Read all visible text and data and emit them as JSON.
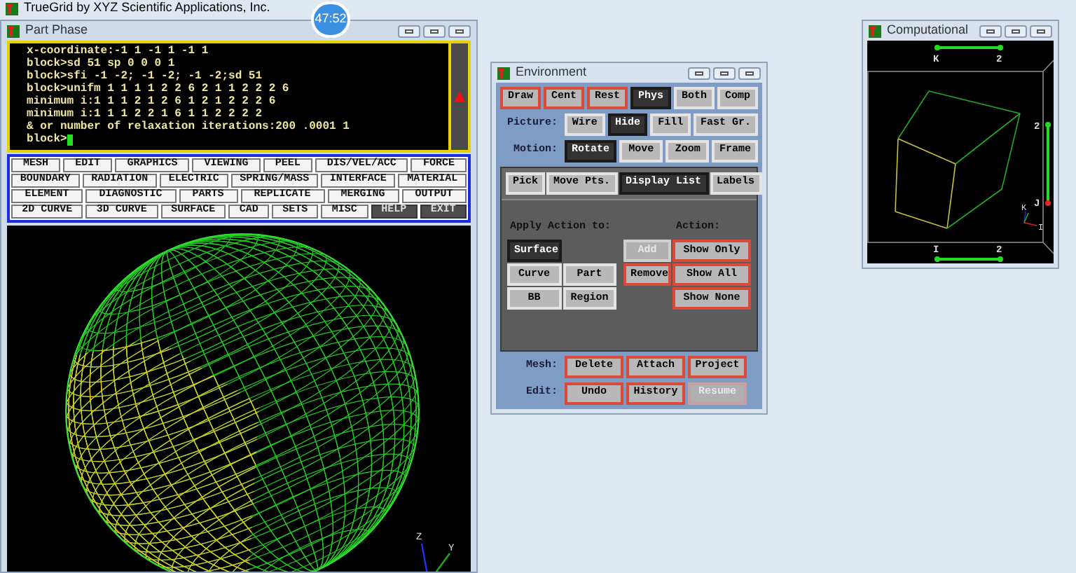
{
  "app_title": "TrueGrid by XYZ Scientific Applications, Inc.",
  "timer": "47:52",
  "part_phase": {
    "title": "Part Phase",
    "console_lines": [
      "x-coordinate:-1 1 -1 1 -1 1",
      "block>sd 51 sp 0 0 0 1",
      "block>sfi -1 -2; -1 -2; -1 -2;sd 51",
      "block>unifm 1 1 1 1 2 2 6 2 1 1 2 2 2 6",
      "minimum i:1 1 1 2 1 2 6 1 2 1 2 2 2 6",
      "minimum i:1 1 1 2 2 1 6 1 1 2 2 2 2",
      "& or number of relaxation iterations:200 .0001 1",
      "block>"
    ],
    "menu_rows": [
      [
        {
          "label": "MESH",
          "kind": "light"
        },
        {
          "label": "EDIT",
          "kind": "light"
        },
        {
          "label": "GRAPHICS",
          "kind": "light"
        },
        {
          "label": "VIEWING",
          "kind": "light"
        },
        {
          "label": "PEEL",
          "kind": "light"
        },
        {
          "label": "DIS/VEL/ACC",
          "kind": "light"
        },
        {
          "label": "FORCE",
          "kind": "light"
        }
      ],
      [
        {
          "label": "BOUNDARY",
          "kind": "light"
        },
        {
          "label": "RADIATION",
          "kind": "light"
        },
        {
          "label": "ELECTRIC",
          "kind": "light"
        },
        {
          "label": "SPRING/MASS",
          "kind": "light"
        },
        {
          "label": "INTERFACE",
          "kind": "light"
        },
        {
          "label": "MATERIAL",
          "kind": "light"
        }
      ],
      [
        {
          "label": "ELEMENT",
          "kind": "light"
        },
        {
          "label": "DIAGNOSTIC",
          "kind": "light"
        },
        {
          "label": "PARTS",
          "kind": "light"
        },
        {
          "label": "REPLICATE",
          "kind": "light"
        },
        {
          "label": "MERGING",
          "kind": "light"
        },
        {
          "label": "OUTPUT",
          "kind": "light"
        }
      ],
      [
        {
          "label": "2D CURVE",
          "kind": "light"
        },
        {
          "label": "3D CURVE",
          "kind": "light"
        },
        {
          "label": "SURFACE",
          "kind": "light"
        },
        {
          "label": "CAD",
          "kind": "light"
        },
        {
          "label": "SETS",
          "kind": "light"
        },
        {
          "label": "MISC",
          "kind": "light"
        },
        {
          "label": "HELP",
          "kind": "dark"
        },
        {
          "label": "EXIT",
          "kind": "dark"
        }
      ]
    ],
    "axis_labels": [
      "Z",
      "Y"
    ]
  },
  "environment": {
    "title": "Environment",
    "view_buttons": [
      {
        "label": "Draw",
        "kind": "command",
        "selected": false
      },
      {
        "label": "Cent",
        "kind": "command",
        "selected": false
      },
      {
        "label": "Rest",
        "kind": "command",
        "selected": false
      },
      {
        "label": "Phys",
        "kind": "toggle",
        "selected": true
      },
      {
        "label": "Both",
        "kind": "toggle",
        "selected": false
      },
      {
        "label": "Comp",
        "kind": "toggle",
        "selected": false
      }
    ],
    "picture": {
      "label": "Picture:",
      "options": [
        {
          "label": "Wire",
          "selected": false
        },
        {
          "label": "Hide",
          "selected": true
        },
        {
          "label": "Fill",
          "selected": false
        },
        {
          "label": "Fast Gr.",
          "selected": false
        }
      ]
    },
    "motion": {
      "label": "Motion:",
      "options": [
        {
          "label": "Rotate",
          "selected": true
        },
        {
          "label": "Move",
          "selected": false
        },
        {
          "label": "Zoom",
          "selected": false
        },
        {
          "label": "Frame",
          "selected": false
        }
      ]
    },
    "tabs": [
      {
        "label": "Pick",
        "selected": false
      },
      {
        "label": "Move Pts.",
        "selected": false
      },
      {
        "label": "Display List",
        "selected": true
      },
      {
        "label": "Labels",
        "selected": false
      }
    ],
    "apply_label": "Apply Action to:",
    "action_label": "Action:",
    "targets": [
      {
        "label": "Surface",
        "selected": true
      },
      {
        "label": "Curve",
        "selected": false
      },
      {
        "label": "Part",
        "selected": false
      },
      {
        "label": "BB",
        "selected": false
      },
      {
        "label": "Region",
        "selected": false
      }
    ],
    "actions": [
      {
        "label": "Add",
        "kind": "plain",
        "disabled": true
      },
      {
        "label": "Show Only",
        "kind": "command",
        "disabled": false
      },
      {
        "label": "Remove",
        "kind": "command",
        "disabled": false
      },
      {
        "label": "Show All",
        "kind": "command",
        "disabled": false
      },
      {
        "label": "Show None",
        "kind": "command",
        "disabled": false
      }
    ],
    "mesh": {
      "label": "Mesh:",
      "buttons": [
        {
          "label": "Delete",
          "disabled": false
        },
        {
          "label": "Attach",
          "disabled": false
        },
        {
          "label": "Project",
          "disabled": false
        }
      ]
    },
    "edit": {
      "label": "Edit:",
      "buttons": [
        {
          "label": "Undo",
          "disabled": false
        },
        {
          "label": "History",
          "disabled": false
        },
        {
          "label": "Resume",
          "disabled": true
        }
      ]
    }
  },
  "computational": {
    "title": "Computational",
    "top_axis": {
      "start": "K",
      "end": "2"
    },
    "right_axis": {
      "start": "J",
      "end": "2"
    },
    "bottom_axis": {
      "start": "I",
      "end": "2"
    },
    "triad_labels": [
      "K",
      "I"
    ]
  }
}
